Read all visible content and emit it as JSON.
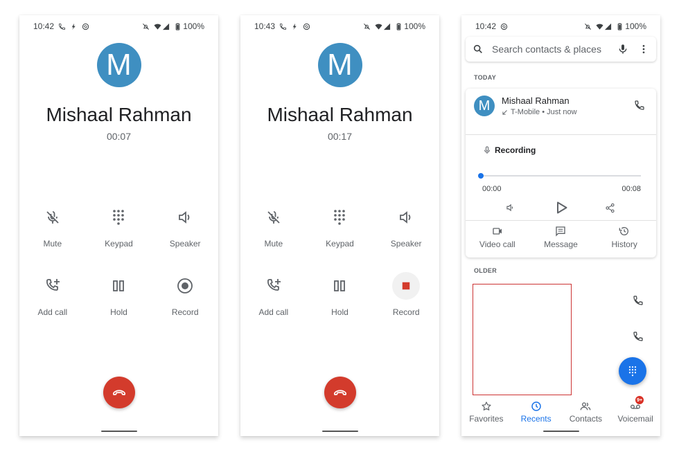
{
  "screens": [
    {
      "status": {
        "time": "10:42",
        "battery": "100%"
      },
      "contact_initial": "M",
      "caller_name": "Mishaal Rahman",
      "call_timer": "00:07",
      "controls": [
        {
          "icon": "mic-off-icon",
          "label": "Mute"
        },
        {
          "icon": "dialpad-icon",
          "label": "Keypad"
        },
        {
          "icon": "speaker-icon",
          "label": "Speaker"
        },
        {
          "icon": "add-call-icon",
          "label": "Add call"
        },
        {
          "icon": "pause-icon",
          "label": "Hold"
        },
        {
          "icon": "record-icon",
          "label": "Record"
        }
      ],
      "recording_active": false
    },
    {
      "status": {
        "time": "10:43",
        "battery": "100%"
      },
      "contact_initial": "M",
      "caller_name": "Mishaal Rahman",
      "call_timer": "00:17",
      "controls": [
        {
          "icon": "mic-off-icon",
          "label": "Mute"
        },
        {
          "icon": "dialpad-icon",
          "label": "Keypad"
        },
        {
          "icon": "speaker-icon",
          "label": "Speaker"
        },
        {
          "icon": "add-call-icon",
          "label": "Add call"
        },
        {
          "icon": "pause-icon",
          "label": "Hold"
        },
        {
          "icon": "stop-record-icon",
          "label": "Record"
        }
      ],
      "recording_active": true
    }
  ],
  "recents": {
    "status": {
      "time": "10:42",
      "battery": "100%"
    },
    "search_placeholder": "Search contacts & places",
    "today_label": "TODAY",
    "older_label": "OLDER",
    "entry": {
      "initial": "M",
      "name": "Mishaal Rahman",
      "detail": "T-Mobile • Just now",
      "call_direction": "incoming"
    },
    "recording": {
      "title": "Recording",
      "current_time": "00:00",
      "total_time": "00:08",
      "progress": 0.0
    },
    "actions": [
      {
        "icon": "video-call-icon",
        "label": "Video call"
      },
      {
        "icon": "message-icon",
        "label": "Message"
      },
      {
        "icon": "history-icon",
        "label": "History"
      }
    ],
    "nav": [
      {
        "icon": "star-icon",
        "label": "Favorites",
        "active": false
      },
      {
        "icon": "clock-icon",
        "label": "Recents",
        "active": true
      },
      {
        "icon": "contacts-icon",
        "label": "Contacts",
        "active": false
      },
      {
        "icon": "voicemail-icon",
        "label": "Voicemail",
        "active": false,
        "badge": "9+"
      }
    ]
  },
  "colors": {
    "avatar": "#3f8fc1",
    "end_call": "#d33b2c",
    "accent": "#1a73e8",
    "record_stop": "#d33b2c",
    "redaction": "#cc3333"
  }
}
